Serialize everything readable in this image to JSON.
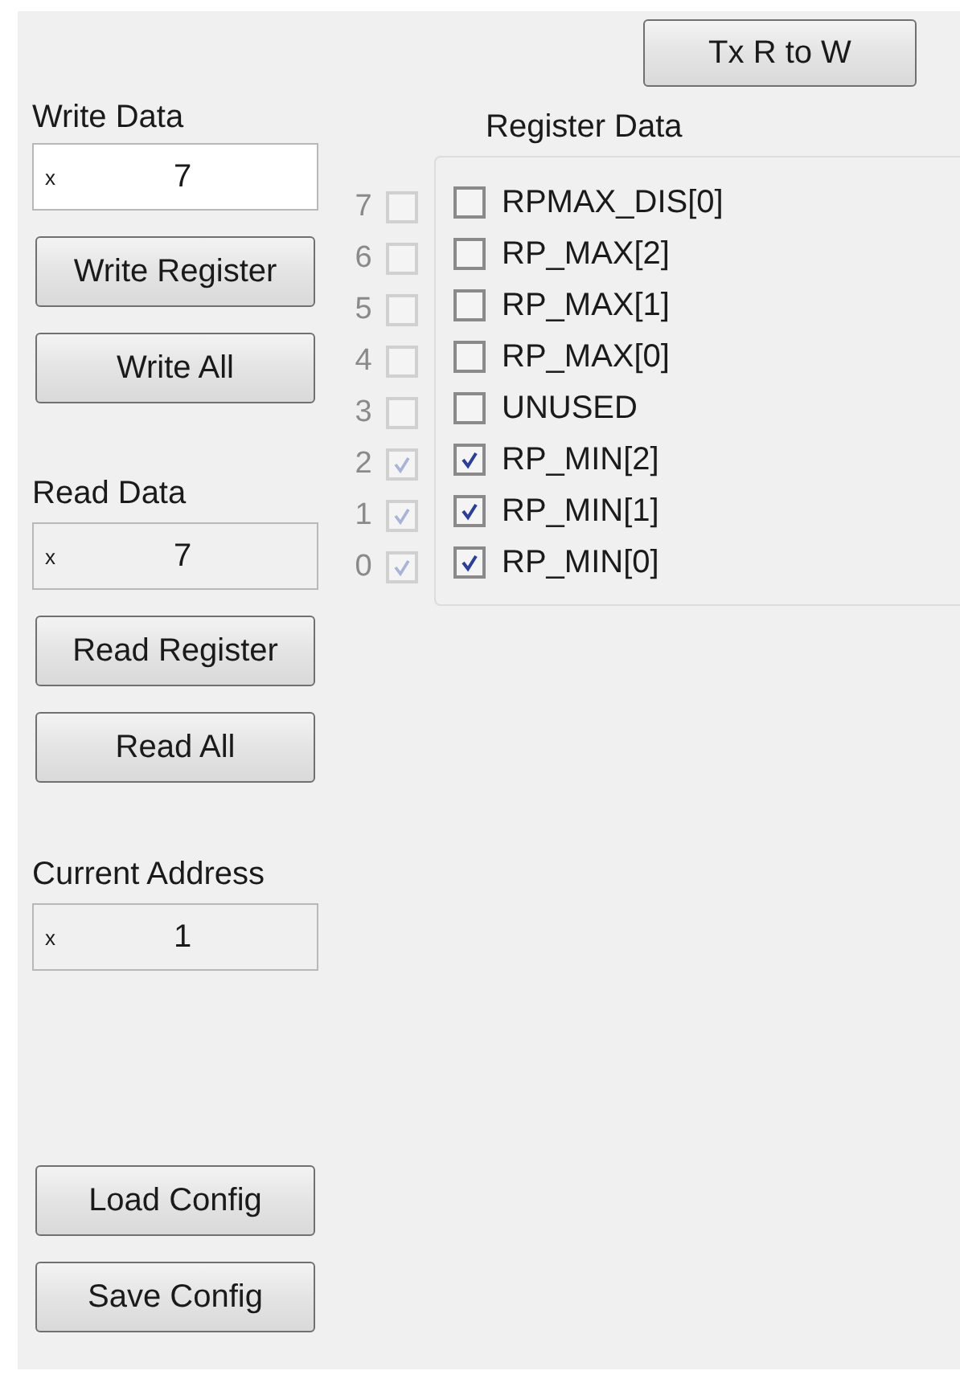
{
  "tx_button": "Tx R to W",
  "write_data": {
    "label": "Write Data",
    "prefix": "x",
    "value": "7"
  },
  "write_buttons": [
    "Write Register",
    "Write All"
  ],
  "read_data": {
    "label": "Read Data",
    "prefix": "x",
    "value": "7"
  },
  "read_buttons": [
    "Read Register",
    "Read All"
  ],
  "current_address": {
    "label": "Current Address",
    "prefix": "x",
    "value": "1"
  },
  "config_buttons": [
    "Load Config",
    "Save Config"
  ],
  "register_data": {
    "title": "Register Data",
    "bits": [
      {
        "bit": "7",
        "name": "RPMAX_DIS[0]",
        "checked": false
      },
      {
        "bit": "6",
        "name": "RP_MAX[2]",
        "checked": false
      },
      {
        "bit": "5",
        "name": "RP_MAX[1]",
        "checked": false
      },
      {
        "bit": "4",
        "name": "RP_MAX[0]",
        "checked": false
      },
      {
        "bit": "3",
        "name": "UNUSED",
        "checked": false
      },
      {
        "bit": "2",
        "name": "RP_MIN[2]",
        "checked": true
      },
      {
        "bit": "1",
        "name": "RP_MIN[1]",
        "checked": true
      },
      {
        "bit": "0",
        "name": "RP_MIN[0]",
        "checked": true
      }
    ]
  }
}
